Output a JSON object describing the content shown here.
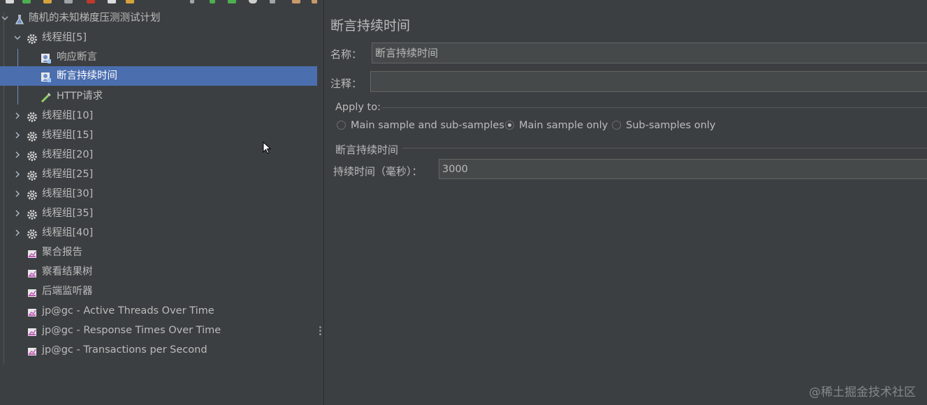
{
  "tree": {
    "root_label": "随机的未知梯度压测测试计划",
    "items": [
      {
        "label": "线程组[5]"
      },
      {
        "label": "响应断言"
      },
      {
        "label": "断言持续时间"
      },
      {
        "label": "HTTP请求"
      },
      {
        "label": "线程组[10]"
      },
      {
        "label": "线程组[15]"
      },
      {
        "label": "线程组[20]"
      },
      {
        "label": "线程组[25]"
      },
      {
        "label": "线程组[30]"
      },
      {
        "label": "线程组[35]"
      },
      {
        "label": "线程组[40]"
      },
      {
        "label": "聚合报告"
      },
      {
        "label": "察看结果树"
      },
      {
        "label": "后端监听器"
      },
      {
        "label": "jp@gc - Active Threads Over Time"
      },
      {
        "label": "jp@gc - Response Times Over Time"
      },
      {
        "label": "jp@gc - Transactions per Second"
      }
    ]
  },
  "panel": {
    "title": "断言持续时间",
    "name_label": "名称：",
    "name_value": "断言持续时间",
    "comment_label": "注释：",
    "comment_value": "",
    "apply_to_label": "Apply to:",
    "radio_main_sub": "Main sample and sub-samples",
    "radio_main_only": "Main sample only",
    "radio_sub_only": "Sub-samples only",
    "selected_radio": "Main sample only",
    "section_label": "断言持续时间",
    "duration_label": "持续时间（毫秒）：",
    "duration_value": "3000"
  },
  "watermark": "@稀土掘金技术社区",
  "colors": {
    "background": "#3c3f41",
    "selection": "#4b6eaf",
    "field_bg": "#45494a",
    "text": "#bbbbbb"
  }
}
